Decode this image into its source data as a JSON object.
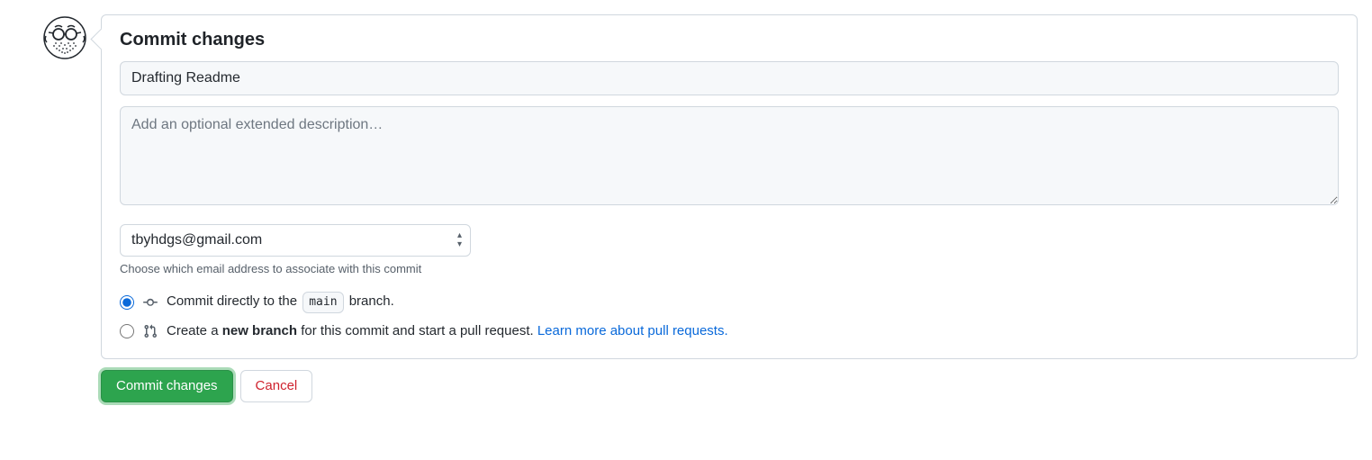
{
  "heading": "Commit changes",
  "summary": {
    "value": "Drafting Readme"
  },
  "description": {
    "placeholder": "Add an optional extended description…"
  },
  "email": {
    "selected": "tbyhdgs@gmail.com",
    "helper": "Choose which email address to associate with this commit"
  },
  "options": {
    "direct": {
      "prefix": "Commit directly to the ",
      "branch": "main",
      "suffix": " branch."
    },
    "newbranch": {
      "prefix": "Create a ",
      "bold": "new branch",
      "suffix": " for this commit and start a pull request. ",
      "link": "Learn more about pull requests."
    }
  },
  "actions": {
    "commit": "Commit changes",
    "cancel": "Cancel"
  }
}
